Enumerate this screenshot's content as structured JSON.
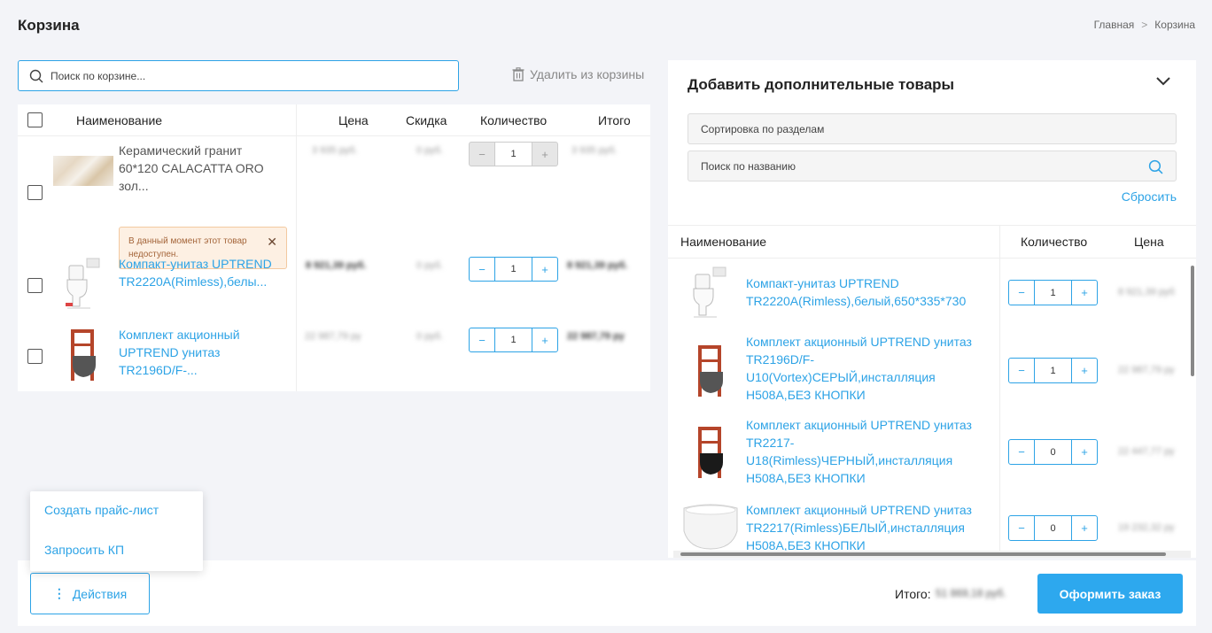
{
  "colors": {
    "accent": "#2da3e6",
    "warning_bg": "#fdf0e3",
    "page_bg": "#f3f4f8"
  },
  "header": {
    "title": "Корзина",
    "breadcrumb": [
      {
        "label": "Главная"
      },
      {
        "label": "Корзина"
      }
    ]
  },
  "cart": {
    "search_placeholder": "Поиск по корзине...",
    "delete_label": "Удалить из корзины",
    "columns": {
      "name": "Наименование",
      "price": "Цена",
      "discount": "Скидка",
      "qty": "Количество",
      "total": "Итого"
    },
    "items": [
      {
        "name": "Керамический гранит 60*120 CALACATTA ORO зол...",
        "price": "3 935 руб.",
        "discount": "0 руб.",
        "qty": "1",
        "total": "3 935 руб.",
        "available": false,
        "alert": "В данный момент этот товар недоступен."
      },
      {
        "name": "Компакт-унитаз UPTREND TR2220A(Rimless),белы...",
        "price": "8 921,39 руб.",
        "discount": "0 руб.",
        "qty": "1",
        "total": "8 921,39 руб.",
        "available": true
      },
      {
        "name": "Комплект акционный UPTREND унитаз TR2196D/F-...",
        "price": "22 987,79 ру",
        "discount": "0 руб.",
        "qty": "1",
        "total": "22 987,79 ру",
        "available": true
      }
    ]
  },
  "add_panel": {
    "title": "Добавить дополнительные товары",
    "sort_placeholder": "Сортировка по разделам",
    "search_placeholder": "Поиск по названию",
    "reset_label": "Сбросить",
    "columns": {
      "name": "Наименование",
      "qty": "Количество",
      "price": "Цена"
    },
    "items": [
      {
        "name": "Компакт-унитаз UPTREND TR2220A(Rimless),белый,650*335*730",
        "qty": "1",
        "price": "8 921,39 руб"
      },
      {
        "name": "Комплект акционный UPTREND унитаз TR2196D/F-U10(Vortex)СЕРЫЙ,инсталляция H508A,БЕЗ КНОПКИ",
        "qty": "1",
        "price": "22 987,79 ру"
      },
      {
        "name": "Комплект акционный UPTREND унитаз TR2217-U18(Rimless)ЧЕРНЫЙ,инсталляция H508A,БЕЗ КНОПКИ",
        "qty": "0",
        "price": "22 447,77 ру"
      },
      {
        "name": "Комплект акционный UPTREND унитаз TR2217(Rimless)БЕЛЫЙ,инсталляция H508A,БЕЗ КНОПКИ",
        "qty": "0",
        "price": "19 232,32 ру"
      }
    ]
  },
  "actions_menu": {
    "items": [
      {
        "label": "Создать прайс-лист"
      },
      {
        "label": "Запросить КП"
      }
    ]
  },
  "footer": {
    "actions_label": "Действия",
    "total_label": "Итого:",
    "total_value": "51 869,18 руб.",
    "order_label": "Оформить заказ"
  }
}
